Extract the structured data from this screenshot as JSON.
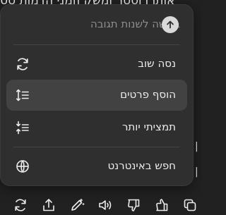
{
  "background": {
    "top_text": "אותו רוסטר ומשק וזמני הדמות טס"
  },
  "menu": {
    "prompt_placeholder": "בקשה לשנות תגובה",
    "items": [
      {
        "label": "נסה שוב",
        "icon": "refresh-icon"
      },
      {
        "label": "הוסף פרטים",
        "icon": "expand-lines-icon",
        "active": true
      },
      {
        "label": "תמציתי יותר",
        "icon": "collapse-lines-icon"
      },
      {
        "label": "חפש באינטרנט",
        "icon": "globe-icon"
      }
    ]
  },
  "toolbar": {
    "icons": [
      "copy-icon",
      "thumbs-up-icon",
      "thumbs-down-icon",
      "read-aloud-icon",
      "edit-icon",
      "share-icon",
      "regenerate-icon"
    ]
  },
  "colors": {
    "page_bg": "#212121",
    "menu_bg": "#2f2f2f",
    "active_item_bg": "#424242",
    "text": "#ececec",
    "placeholder": "#8e8e8e"
  }
}
